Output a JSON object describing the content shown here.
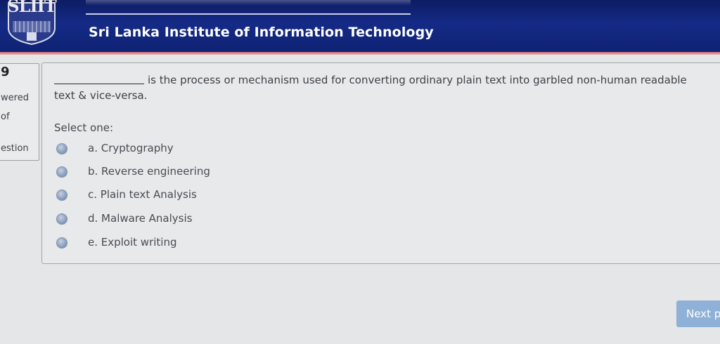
{
  "header": {
    "logo_text": "SLIIT",
    "site_title": "Sri Lanka Institute of Information Technology"
  },
  "info_panel": {
    "question_number": "9",
    "lines": [
      "wered",
      "of",
      "estion"
    ]
  },
  "question": {
    "text": "is the process or mechanism used for converting ordinary plain text into garbled non-human readable text & vice-versa.",
    "select_label": "Select one:",
    "options": [
      {
        "label": "a. Cryptography"
      },
      {
        "label": "b. Reverse engineering"
      },
      {
        "label": "c. Plain text Analysis"
      },
      {
        "label": "d. Malware Analysis"
      },
      {
        "label": "e. Exploit writing"
      }
    ]
  },
  "navigation": {
    "next_label": "Next p"
  },
  "colors": {
    "header_blue": "#142a86",
    "header_accent": "#c96a6a",
    "next_button": "#8fb1d7"
  }
}
